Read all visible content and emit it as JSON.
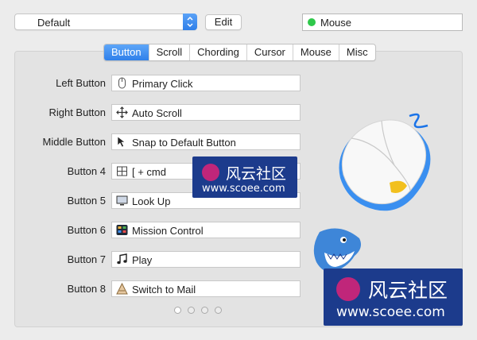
{
  "profile": {
    "selected": "Default",
    "edit_label": "Edit"
  },
  "device": {
    "name": "Mouse",
    "status_color": "#2ec84a"
  },
  "tabs": [
    "Button",
    "Scroll",
    "Chording",
    "Cursor",
    "Mouse",
    "Misc"
  ],
  "active_tab": "Button",
  "buttons": [
    {
      "label": "Left Button",
      "action": "Primary Click",
      "icon": "mouse-click-icon"
    },
    {
      "label": "Right Button",
      "action": "Auto Scroll",
      "icon": "four-arrows-icon"
    },
    {
      "label": "Middle Button",
      "action": "Snap to Default Button",
      "icon": "cursor-arrow-icon"
    },
    {
      "label": "Button 4",
      "action": "[ + cmd",
      "icon": "keyboard-shortcut-icon"
    },
    {
      "label": "Button 5",
      "action": "Look Up",
      "icon": "monitor-icon"
    },
    {
      "label": "Button 6",
      "action": "Mission Control",
      "icon": "mission-control-icon"
    },
    {
      "label": "Button 7",
      "action": "Play",
      "icon": "music-note-icon"
    },
    {
      "label": "Button 8",
      "action": "Switch to Mail",
      "icon": "app-icon"
    }
  ],
  "pager": {
    "pages": 4,
    "current": 1
  },
  "watermark": {
    "cn": "风云社区",
    "url": "www.scoee.com"
  },
  "colors": {
    "accent": "#2f80ea",
    "watermark_bg": "#1c3b8c",
    "logo": "#c0267a"
  }
}
